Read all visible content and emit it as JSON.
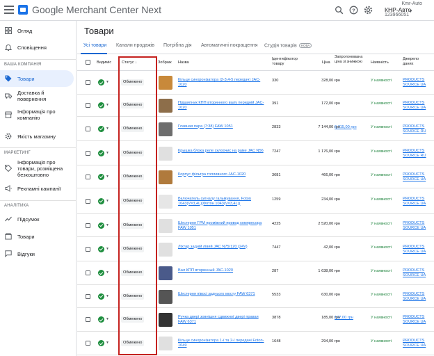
{
  "header": {
    "app_title": "Google Merchant Center Next",
    "account": {
      "top_label": "Kmr-Auto",
      "name": "КНР-Авто",
      "id": "123966051"
    }
  },
  "sidebar": {
    "items": [
      {
        "label": "Огляд",
        "icon": "grid-icon"
      },
      {
        "label": "Сповіщення",
        "icon": "bell-icon"
      }
    ],
    "section_company": "ВАША КОМПАНІЯ",
    "company_items": [
      {
        "label": "Товари",
        "icon": "tag-icon",
        "active": true
      },
      {
        "label": "Доставка й повернення",
        "icon": "truck-icon"
      },
      {
        "label": "Інформація про компанію",
        "icon": "store-icon"
      },
      {
        "label": "Якість магазину",
        "icon": "gear-badge-icon"
      }
    ],
    "section_marketing": "МАРКЕТИНГ",
    "marketing_items": [
      {
        "label": "Інформація про товари, розміщена безкоштовно",
        "icon": "tag-outline-icon"
      },
      {
        "label": "Рекламні кампанії",
        "icon": "megaphone-icon"
      }
    ],
    "section_analytics": "АНАЛІТИКА",
    "analytics_items": [
      {
        "label": "Підсумок",
        "icon": "trend-icon"
      },
      {
        "label": "Товари",
        "icon": "box-icon"
      },
      {
        "label": "Відгуки",
        "icon": "chat-icon"
      }
    ]
  },
  "page": {
    "title": "Товари"
  },
  "tabs": [
    {
      "label": "Усі товари",
      "active": true
    },
    {
      "label": "Канали продажів"
    },
    {
      "label": "Потрібна дія"
    },
    {
      "label": "Автоматичні покращення"
    },
    {
      "label": "Студія товарів",
      "badge": "НОВА"
    }
  ],
  "table": {
    "columns": {
      "visibility": "Видиміс",
      "status": "Статус",
      "image": "Зображ",
      "name": "Назва",
      "id": "Ідентифікатор товару",
      "price": "Ціна",
      "sale_price": "Запропонована ціна зі знижкою",
      "availability": "Наявність",
      "source": "Джерело даних"
    },
    "rows": [
      {
        "status": "Обмежено",
        "name": "Кільце синхронізатора (2-3,4-5 передач) JAC-1020",
        "id": "330",
        "price": "328,00 грн",
        "sale": "-",
        "avail": "У наявності",
        "source": "PRODUCTS SOURCE UA",
        "thumb": "#c8893a"
      },
      {
        "status": "Обмежено",
        "name": "Підшипник КПП вторинного валу передній JAC-1020",
        "id": "391",
        "price": "172,00 грн",
        "sale": "-",
        "avail": "У наявності",
        "source": "PRODUCTS SOURCE UA",
        "thumb": "#8d6e4a"
      },
      {
        "status": "Обмежено",
        "name": "Главная пара (7:38) FAW 1051",
        "id": "2833",
        "price": "7 144,00 грн",
        "sale": "6 715,00 грн",
        "avail": "У наявності",
        "source": "PRODUCTS SOURCE RU",
        "thumb": "#6d6d6d"
      },
      {
        "status": "Обмежено",
        "name": "Крышка блока реле склоочис на раме JAC N56",
        "id": "7247",
        "price": "1 176,00 грн",
        "sale": "-",
        "avail": "У наявності",
        "source": "PRODUCTS SOURCE RU",
        "thumb": "#e0e0e0"
      },
      {
        "status": "Обмежено",
        "name": "Корпус фільтра топливного JAC-1020",
        "id": "3681",
        "price": "466,00 грн",
        "sale": "-",
        "avail": "У наявності",
        "source": "PRODUCTS SOURCE UA",
        "thumb": "#b07a3c"
      },
      {
        "status": "Обмежено",
        "name": "Включатель сигналу гальмування, Foton 1043(V=3,4L)(Фотон 1043(V=3,4L))",
        "id": "1259",
        "price": "234,00 грн",
        "sale": "-",
        "avail": "У наявності",
        "source": "PRODUCTS SOURCE UA",
        "thumb": "#e6e6e6"
      },
      {
        "status": "Обмежено",
        "name": "Шестерня ГРМ проміжний привод компресора FAW 1051",
        "id": "4225",
        "price": "2 520,00 грн",
        "sale": "-",
        "avail": "У наявності",
        "source": "PRODUCTS SOURCE UA",
        "thumb": "#e0e0e0"
      },
      {
        "status": "Обмежено",
        "name": "Ліхтар задній лівий JAC N75/120 (24V)",
        "id": "7447",
        "price": "42,00 грн",
        "sale": "-",
        "avail": "У наявності",
        "source": "PRODUCTS SOURCE UA",
        "thumb": "#e0e0e0"
      },
      {
        "status": "Обмежено",
        "name": "Вал КПП вторинный JAC-1020",
        "id": "287",
        "price": "1 638,00 грн",
        "sale": "-",
        "avail": "У наявності",
        "source": "PRODUCTS SOURCE UA",
        "thumb": "#4a5a8a"
      },
      {
        "status": "Обмежено",
        "name": "Шестерня півосі заднього мосту FAW 6371",
        "id": "5533",
        "price": "630,00 грн",
        "sale": "-",
        "avail": "У наявності",
        "source": "PRODUCTS SOURCE UA",
        "thumb": "#555555"
      },
      {
        "status": "Обмежено",
        "name": "Ручка двері зовнішня сдвижної двері правая FAW 6371",
        "id": "3878",
        "price": "185,00 грн",
        "sale": "177,00 грн",
        "avail": "У наявності",
        "source": "PRODUCTS SOURCE UA",
        "thumb": "#333333"
      },
      {
        "status": "Обмежено",
        "name": "Кільце синхронізатора 1-ї та 2-ї передачі Foton-1049",
        "id": "1648",
        "price": "294,00 грн",
        "sale": "-",
        "avail": "У наявності",
        "source": "PRODUCTS SOURCE UA",
        "thumb": "#e0e0e0"
      }
    ]
  },
  "highlight_color": "#c5221f"
}
